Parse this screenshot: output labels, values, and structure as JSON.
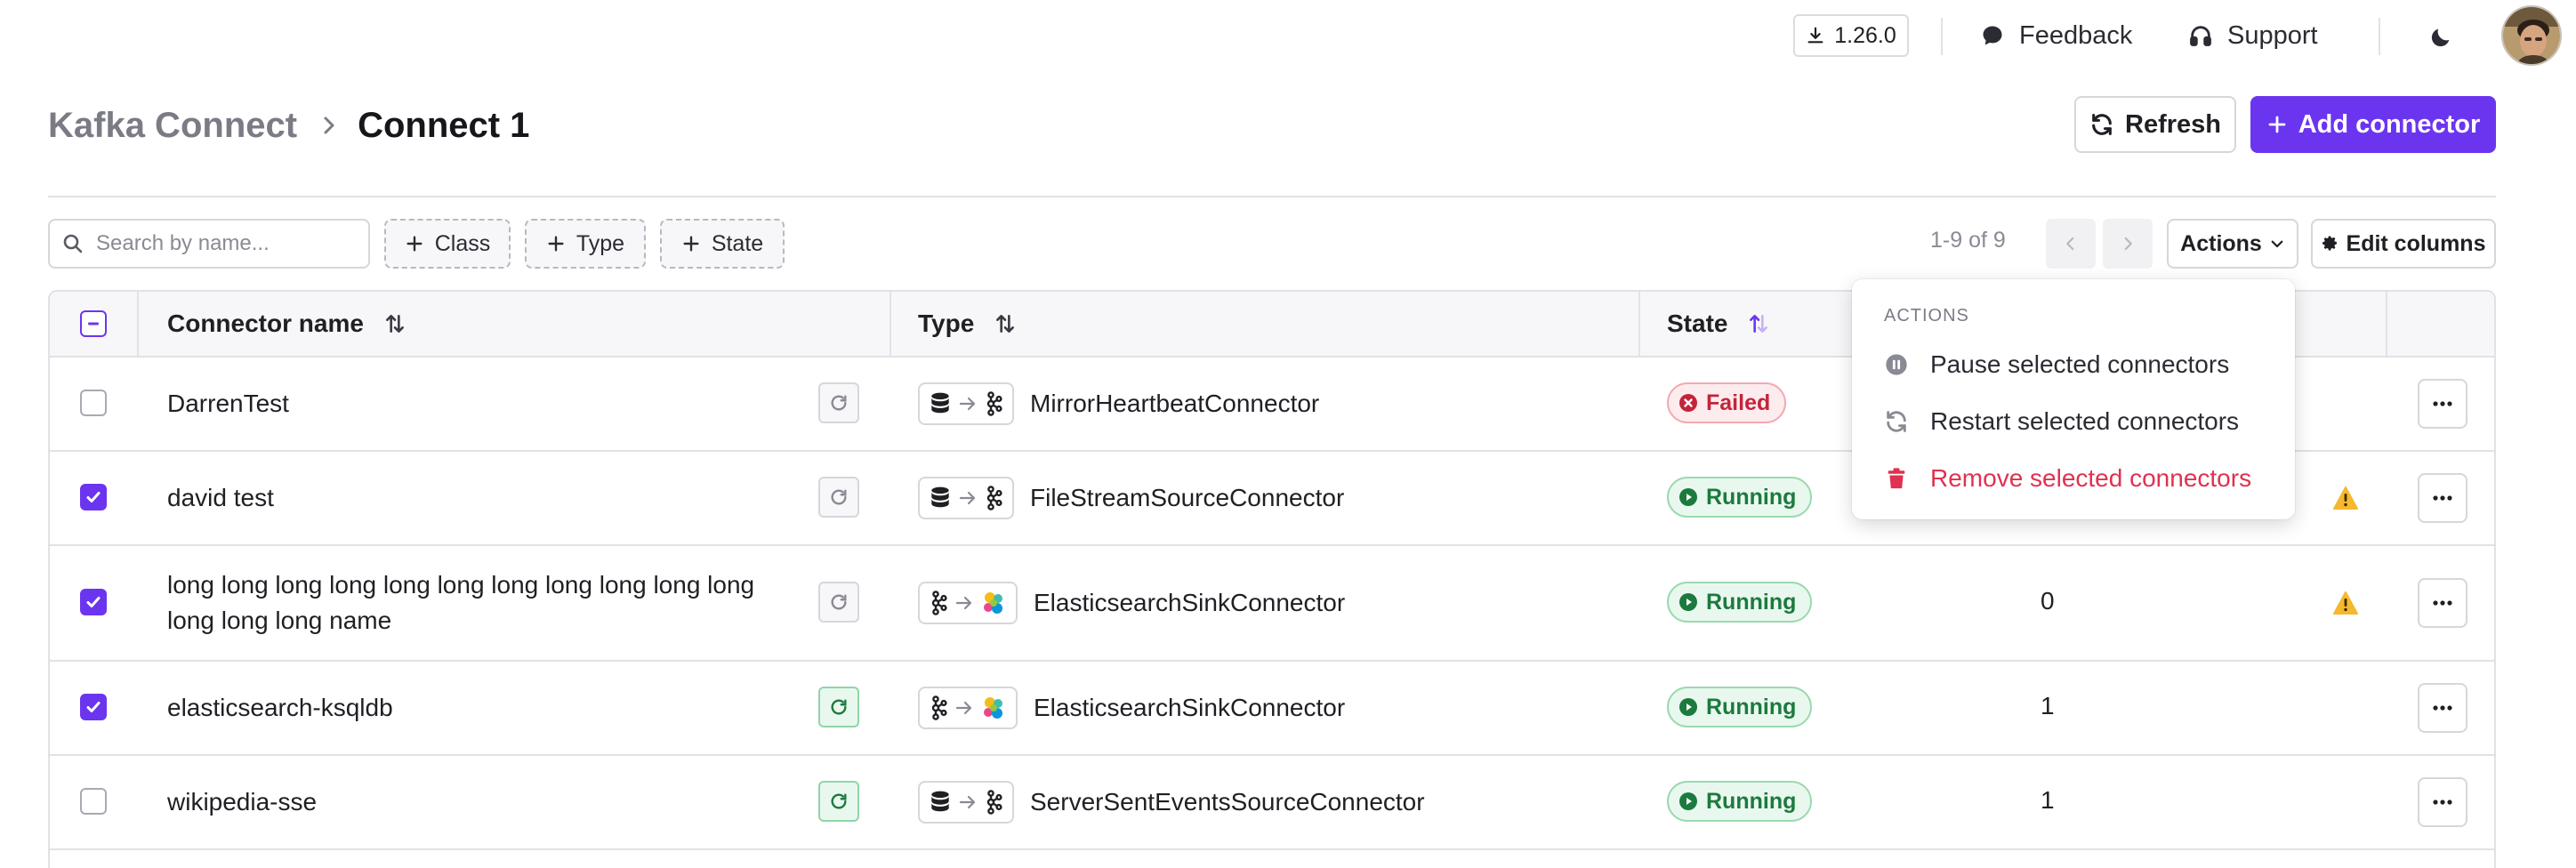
{
  "topbar": {
    "version": "1.26.0",
    "feedback": "Feedback",
    "support": "Support"
  },
  "header": {
    "breadcrumb_parent": "Kafka Connect",
    "breadcrumb_current": "Connect 1",
    "refresh": "Refresh",
    "add_connector": "Add connector"
  },
  "filters": {
    "search_placeholder": "Search by name...",
    "class": "Class",
    "type": "Type",
    "state": "State"
  },
  "pagination": {
    "text": "1-9 of 9"
  },
  "toolbar": {
    "actions": "Actions",
    "edit_columns": "Edit columns"
  },
  "table": {
    "columns": {
      "name": "Connector name",
      "type": "Type",
      "state": "State"
    },
    "rows": [
      {
        "checked": false,
        "name": "DarrenTest",
        "restart_active": false,
        "flow": "db-to-kafka",
        "type": "MirrorHeartbeatConnector",
        "state": "Failed",
        "tasks": "",
        "warning": false
      },
      {
        "checked": true,
        "name": "david test",
        "restart_active": false,
        "flow": "db-to-kafka",
        "type": "FileStreamSourceConnector",
        "state": "Running",
        "tasks": "",
        "warning": true
      },
      {
        "checked": true,
        "name": "long long long long long long long long long long long long long long name",
        "restart_active": false,
        "flow": "kafka-to-elastic",
        "type": "ElasticsearchSinkConnector",
        "state": "Running",
        "tasks": "0",
        "warning": true
      },
      {
        "checked": true,
        "name": "elasticsearch-ksqldb",
        "restart_active": true,
        "flow": "kafka-to-elastic",
        "type": "ElasticsearchSinkConnector",
        "state": "Running",
        "tasks": "1",
        "warning": false
      },
      {
        "checked": false,
        "name": "wikipedia-sse",
        "restart_active": true,
        "flow": "db-to-kafka",
        "type": "ServerSentEventsSourceConnector",
        "state": "Running",
        "tasks": "1",
        "warning": false
      }
    ]
  },
  "actions_menu": {
    "heading": "ACTIONS",
    "pause": "Pause selected connectors",
    "restart": "Restart selected connectors",
    "remove": "Remove selected connectors"
  },
  "colors": {
    "accent": "#6b35f0",
    "running": "#1c7a3e",
    "failed": "#c3243b",
    "danger": "#e03150",
    "warning": "#f5b82e"
  }
}
